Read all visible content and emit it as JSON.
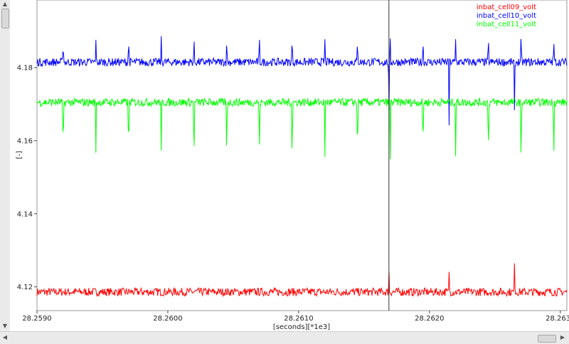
{
  "chart_data": {
    "type": "line",
    "title": "",
    "xlabel": "[seconds][*1e3]",
    "ylabel": "[-]",
    "xlim": [
      28.259,
      28.26305
    ],
    "ylim": [
      4.1135,
      4.1985
    ],
    "x_ticks": [
      28.259,
      28.26,
      28.261,
      28.262,
      28.263
    ],
    "x_tick_labels": [
      "28.2590",
      "28.2600",
      "28.2610",
      "28.2620",
      "28.2630"
    ],
    "y_ticks": [
      4.12,
      4.14,
      4.16,
      4.18
    ],
    "y_tick_labels": [
      "4.12",
      "4.14",
      "4.16",
      "4.18"
    ],
    "grid": false,
    "legend_position": "top-right",
    "cursor_x": 28.26169,
    "series": [
      {
        "name": "inbat_cell09_volt",
        "color": "#ff0000",
        "baseline": 4.1186,
        "noise": 0.0011,
        "spikes": [
          {
            "x": 28.26169,
            "y": 4.1255
          },
          {
            "x": 28.26215,
            "y": 4.1246
          },
          {
            "x": 28.26265,
            "y": 4.1285
          }
        ]
      },
      {
        "name": "inbat_cell10_volt",
        "color": "#0000ff",
        "baseline": 4.1815,
        "noise": 0.0011,
        "spikes": [
          {
            "x": 28.2592,
            "y": 4.1883
          },
          {
            "x": 28.25945,
            "y": 4.1883
          },
          {
            "x": 28.2597,
            "y": 4.1883
          },
          {
            "x": 28.25995,
            "y": 4.1883
          },
          {
            "x": 28.2602,
            "y": 4.1883
          },
          {
            "x": 28.26045,
            "y": 4.1883
          },
          {
            "x": 28.2607,
            "y": 4.1883
          },
          {
            "x": 28.26095,
            "y": 4.1883
          },
          {
            "x": 28.2612,
            "y": 4.1883
          },
          {
            "x": 28.26145,
            "y": 4.1883
          },
          {
            "x": 28.2617,
            "y": 4.1883
          },
          {
            "x": 28.26195,
            "y": 4.1883
          },
          {
            "x": 28.2622,
            "y": 4.1883
          },
          {
            "x": 28.26245,
            "y": 4.1883
          },
          {
            "x": 28.2627,
            "y": 4.1883
          },
          {
            "x": 28.26295,
            "y": 4.1883
          },
          {
            "x": 28.26169,
            "y": 4.1635
          },
          {
            "x": 28.26215,
            "y": 4.1645
          },
          {
            "x": 28.26265,
            "y": 4.1655
          }
        ]
      },
      {
        "name": "inbat_cell11_volt",
        "color": "#00ff00",
        "baseline": 4.1705,
        "noise": 0.0011,
        "spikes": [
          {
            "x": 28.2592,
            "y": 4.154
          },
          {
            "x": 28.25945,
            "y": 4.156
          },
          {
            "x": 28.2597,
            "y": 4.1545
          },
          {
            "x": 28.25995,
            "y": 4.1545
          },
          {
            "x": 28.2602,
            "y": 4.1515
          },
          {
            "x": 28.26045,
            "y": 4.1545
          },
          {
            "x": 28.2607,
            "y": 4.1545
          },
          {
            "x": 28.26095,
            "y": 4.1525
          },
          {
            "x": 28.2612,
            "y": 4.1545
          },
          {
            "x": 28.26145,
            "y": 4.1545
          },
          {
            "x": 28.2617,
            "y": 4.1545
          },
          {
            "x": 28.26195,
            "y": 4.156
          },
          {
            "x": 28.2622,
            "y": 4.154
          },
          {
            "x": 28.26245,
            "y": 4.1545
          },
          {
            "x": 28.2627,
            "y": 4.1515
          },
          {
            "x": 28.26295,
            "y": 4.1545
          }
        ]
      }
    ]
  }
}
